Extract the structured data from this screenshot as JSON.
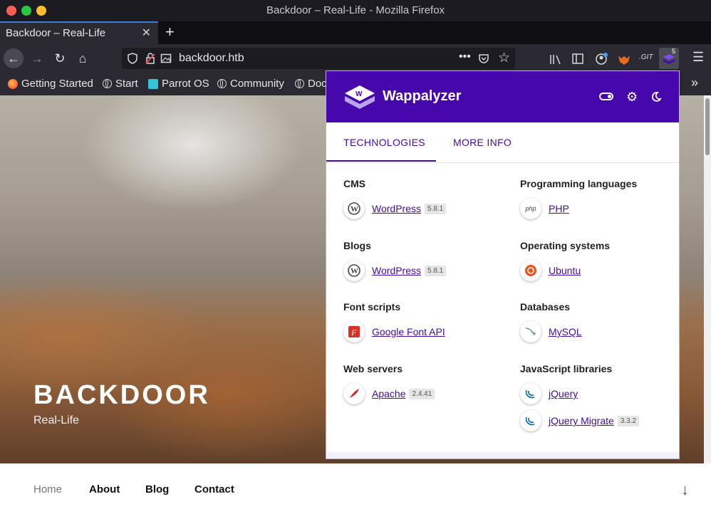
{
  "window": {
    "title": "Backdoor – Real-Life - Mozilla Firefox"
  },
  "tab": {
    "title": "Backdoor – Real-Life",
    "close": "✕",
    "new": "+"
  },
  "nav": {
    "back": "←",
    "forward": "→",
    "reload": "↻",
    "home": "⌂",
    "url": "backdoor.htb",
    "ext_badge": "5",
    "git_label": ".GIT"
  },
  "bookmarks": [
    {
      "label": "Getting Started",
      "icon": "firefox-icon"
    },
    {
      "label": "Start",
      "icon": "globe-icon"
    },
    {
      "label": "Parrot OS",
      "icon": "parrot-icon"
    },
    {
      "label": "Community",
      "icon": "globe-icon"
    },
    {
      "label": "Doc",
      "icon": "globe-icon"
    }
  ],
  "page": {
    "site_title": "BACKDOOR",
    "tagline": "Real-Life",
    "menu": [
      "Home",
      "About",
      "Blog",
      "Contact"
    ]
  },
  "wappalyzer": {
    "title": "Wappalyzer",
    "tabs": [
      "TECHNOLOGIES",
      "MORE INFO"
    ],
    "categories": [
      {
        "name": "CMS",
        "items": [
          {
            "name": "WordPress",
            "version": "5.8.1",
            "icon": "wordpress-icon"
          }
        ]
      },
      {
        "name": "Programming languages",
        "items": [
          {
            "name": "PHP",
            "version": "",
            "icon": "php-icon"
          }
        ]
      },
      {
        "name": "Blogs",
        "items": [
          {
            "name": "WordPress",
            "version": "5.8.1",
            "icon": "wordpress-icon"
          }
        ]
      },
      {
        "name": "Operating systems",
        "items": [
          {
            "name": "Ubuntu",
            "version": "",
            "icon": "ubuntu-icon"
          }
        ]
      },
      {
        "name": "Font scripts",
        "items": [
          {
            "name": "Google Font API",
            "version": "",
            "icon": "google-font-icon"
          }
        ]
      },
      {
        "name": "Databases",
        "items": [
          {
            "name": "MySQL",
            "version": "",
            "icon": "mysql-icon"
          }
        ]
      },
      {
        "name": "Web servers",
        "items": [
          {
            "name": "Apache",
            "version": "2.4.41",
            "icon": "apache-icon"
          }
        ]
      },
      {
        "name": "JavaScript libraries",
        "items": [
          {
            "name": "jQuery",
            "version": "",
            "icon": "jquery-icon"
          },
          {
            "name": "jQuery Migrate",
            "version": "3.3.2",
            "icon": "jquery-icon"
          }
        ]
      }
    ]
  },
  "colors": {
    "accent": "#4608ad",
    "titlebar": "#1c1b22",
    "toolbar": "#2b2a33"
  }
}
